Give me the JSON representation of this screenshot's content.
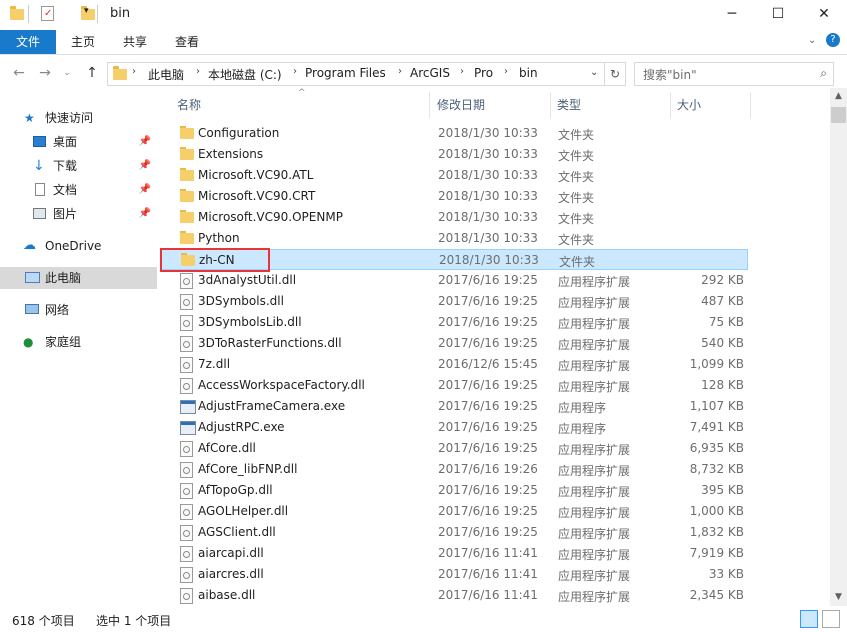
{
  "window": {
    "title": "bin",
    "minimize_icon": "minimize-icon",
    "maximize_icon": "maximize-icon",
    "close_icon": "close-icon"
  },
  "ribbon": {
    "tabs": [
      "文件",
      "主页",
      "共享",
      "查看"
    ],
    "accent": "#1979ca"
  },
  "address": {
    "crumbs": [
      "此电脑",
      "本地磁盘 (C:)",
      "Program Files",
      "ArcGIS",
      "Pro",
      "bin"
    ],
    "search_placeholder": "搜索\"bin\""
  },
  "nav": {
    "items": [
      {
        "label": "快速访问",
        "icon": "star-icon"
      },
      {
        "label": "桌面",
        "icon": "desktop-icon",
        "pinned": true
      },
      {
        "label": "下载",
        "icon": "download-icon",
        "pinned": true
      },
      {
        "label": "文档",
        "icon": "document-icon",
        "pinned": true
      },
      {
        "label": "图片",
        "icon": "pictures-icon",
        "pinned": true
      },
      {
        "label": "OneDrive",
        "icon": "cloud-icon"
      },
      {
        "label": "此电脑",
        "icon": "computer-icon",
        "selected": true
      },
      {
        "label": "网络",
        "icon": "network-icon"
      },
      {
        "label": "家庭组",
        "icon": "homegroup-icon"
      }
    ]
  },
  "columns": [
    "名称",
    "修改日期",
    "类型",
    "大小"
  ],
  "files": [
    {
      "name": "Configuration",
      "date": "2018/1/30 10:33",
      "type": "文件夹",
      "size": "",
      "kind": "folder"
    },
    {
      "name": "Extensions",
      "date": "2018/1/30 10:33",
      "type": "文件夹",
      "size": "",
      "kind": "folder"
    },
    {
      "name": "Microsoft.VC90.ATL",
      "date": "2018/1/30 10:33",
      "type": "文件夹",
      "size": "",
      "kind": "folder"
    },
    {
      "name": "Microsoft.VC90.CRT",
      "date": "2018/1/30 10:33",
      "type": "文件夹",
      "size": "",
      "kind": "folder"
    },
    {
      "name": "Microsoft.VC90.OPENMP",
      "date": "2018/1/30 10:33",
      "type": "文件夹",
      "size": "",
      "kind": "folder"
    },
    {
      "name": "Python",
      "date": "2018/1/30 10:33",
      "type": "文件夹",
      "size": "",
      "kind": "folder"
    },
    {
      "name": "zh-CN",
      "date": "2018/1/30 10:33",
      "type": "文件夹",
      "size": "",
      "kind": "folder",
      "selected": true
    },
    {
      "name": "3dAnalystUtil.dll",
      "date": "2017/6/16 19:25",
      "type": "应用程序扩展",
      "size": "292 KB",
      "kind": "dll"
    },
    {
      "name": "3DSymbols.dll",
      "date": "2017/6/16 19:25",
      "type": "应用程序扩展",
      "size": "487 KB",
      "kind": "dll"
    },
    {
      "name": "3DSymbolsLib.dll",
      "date": "2017/6/16 19:25",
      "type": "应用程序扩展",
      "size": "75 KB",
      "kind": "dll"
    },
    {
      "name": "3DToRasterFunctions.dll",
      "date": "2017/6/16 19:25",
      "type": "应用程序扩展",
      "size": "540 KB",
      "kind": "dll"
    },
    {
      "name": "7z.dll",
      "date": "2016/12/6 15:45",
      "type": "应用程序扩展",
      "size": "1,099 KB",
      "kind": "dll"
    },
    {
      "name": "AccessWorkspaceFactory.dll",
      "date": "2017/6/16 19:25",
      "type": "应用程序扩展",
      "size": "128 KB",
      "kind": "dll"
    },
    {
      "name": "AdjustFrameCamera.exe",
      "date": "2017/6/16 19:25",
      "type": "应用程序",
      "size": "1,107 KB",
      "kind": "exe"
    },
    {
      "name": "AdjustRPC.exe",
      "date": "2017/6/16 19:25",
      "type": "应用程序",
      "size": "7,491 KB",
      "kind": "exe"
    },
    {
      "name": "AfCore.dll",
      "date": "2017/6/16 19:25",
      "type": "应用程序扩展",
      "size": "6,935 KB",
      "kind": "dll"
    },
    {
      "name": "AfCore_libFNP.dll",
      "date": "2017/6/16 19:26",
      "type": "应用程序扩展",
      "size": "8,732 KB",
      "kind": "dll"
    },
    {
      "name": "AfTopoGp.dll",
      "date": "2017/6/16 19:25",
      "type": "应用程序扩展",
      "size": "395 KB",
      "kind": "dll"
    },
    {
      "name": "AGOLHelper.dll",
      "date": "2017/6/16 19:25",
      "type": "应用程序扩展",
      "size": "1,000 KB",
      "kind": "dll"
    },
    {
      "name": "AGSClient.dll",
      "date": "2017/6/16 19:25",
      "type": "应用程序扩展",
      "size": "1,832 KB",
      "kind": "dll"
    },
    {
      "name": "aiarcapi.dll",
      "date": "2017/6/16 11:41",
      "type": "应用程序扩展",
      "size": "7,919 KB",
      "kind": "dll"
    },
    {
      "name": "aiarcres.dll",
      "date": "2017/6/16 11:41",
      "type": "应用程序扩展",
      "size": "33 KB",
      "kind": "dll"
    },
    {
      "name": "aibase.dll",
      "date": "2017/6/16 11:41",
      "type": "应用程序扩展",
      "size": "2,345 KB",
      "kind": "dll"
    }
  ],
  "status": {
    "count": "618 个项目",
    "selected": "选中 1 个项目"
  }
}
